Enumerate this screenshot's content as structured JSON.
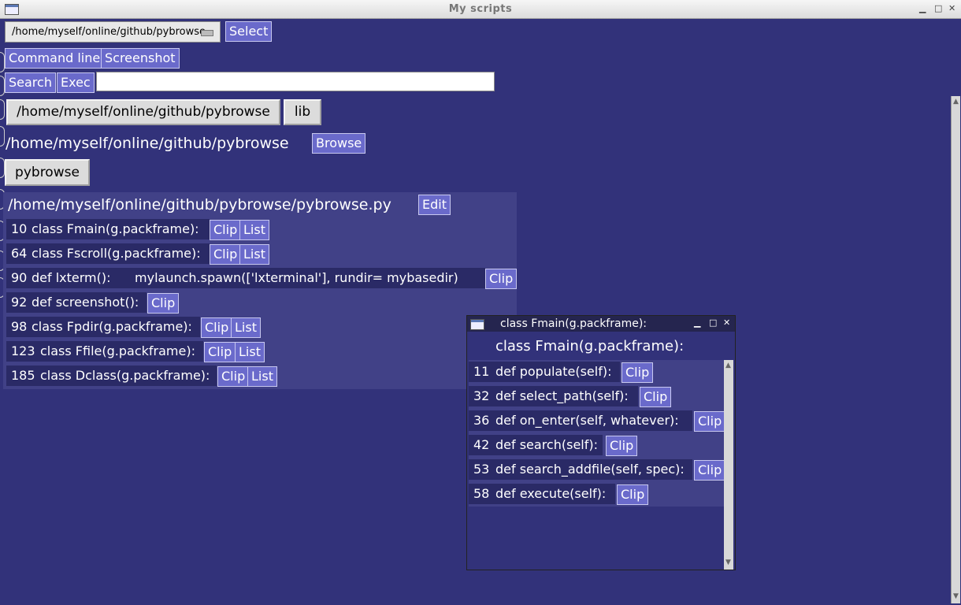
{
  "window": {
    "title": "My scripts"
  },
  "toolbar": {
    "combo_value": "/home/myself/online/github/pybrowse",
    "select_label": "Select",
    "command_line_label": "Command line",
    "screenshot_label": "Screenshot",
    "search_label": "Search",
    "exec_label": "Exec",
    "search_value": ""
  },
  "path_buttons": {
    "path": "/home/myself/online/github/pybrowse",
    "lib": "lib"
  },
  "dir": {
    "path": "/home/myself/online/github/pybrowse",
    "browse_label": "Browse",
    "file_button": "pybrowse"
  },
  "file": {
    "path": "/home/myself/online/github/pybrowse/pybrowse.py",
    "edit_label": "Edit",
    "items": [
      {
        "line": "10",
        "code": "class Fmain(g.packframe):",
        "clip": "Clip",
        "list": "List"
      },
      {
        "line": "64",
        "code": "class Fscroll(g.packframe):",
        "clip": "Clip",
        "list": "List"
      },
      {
        "line": "90",
        "code": "def lxterm():      mylaunch.spawn(['lxterminal'], rundir= mybasedir)",
        "clip": "Clip",
        "list": ""
      },
      {
        "line": "92",
        "code": "def screenshot():",
        "clip": "Clip",
        "list": ""
      },
      {
        "line": "98",
        "code": "class Fpdir(g.packframe):",
        "clip": "Clip",
        "list": "List"
      },
      {
        "line": "123",
        "code": "class Ffile(g.packframe):",
        "clip": "Clip",
        "list": "List"
      },
      {
        "line": "185",
        "code": "class Dclass(g.packframe):",
        "clip": "Clip",
        "list": "List"
      }
    ]
  },
  "popup": {
    "title": "class Fmain(g.packframe):",
    "heading": "class Fmain(g.packframe):",
    "items": [
      {
        "line": "11",
        "code": "def populate(self):",
        "clip": "Clip"
      },
      {
        "line": "32",
        "code": "def select_path(self):",
        "clip": "Clip"
      },
      {
        "line": "36",
        "code": "def on_enter(self, whatever):",
        "clip": "Clip"
      },
      {
        "line": "42",
        "code": "def search(self):",
        "clip": "Clip"
      },
      {
        "line": "53",
        "code": "def search_addfile(self, spec):",
        "clip": "Clip"
      },
      {
        "line": "58",
        "code": "def execute(self):",
        "clip": "Clip"
      }
    ]
  },
  "colors": {
    "background": "#32327a",
    "panel": "#414187",
    "row": "#2a2a66",
    "button": "#6a6acb"
  }
}
